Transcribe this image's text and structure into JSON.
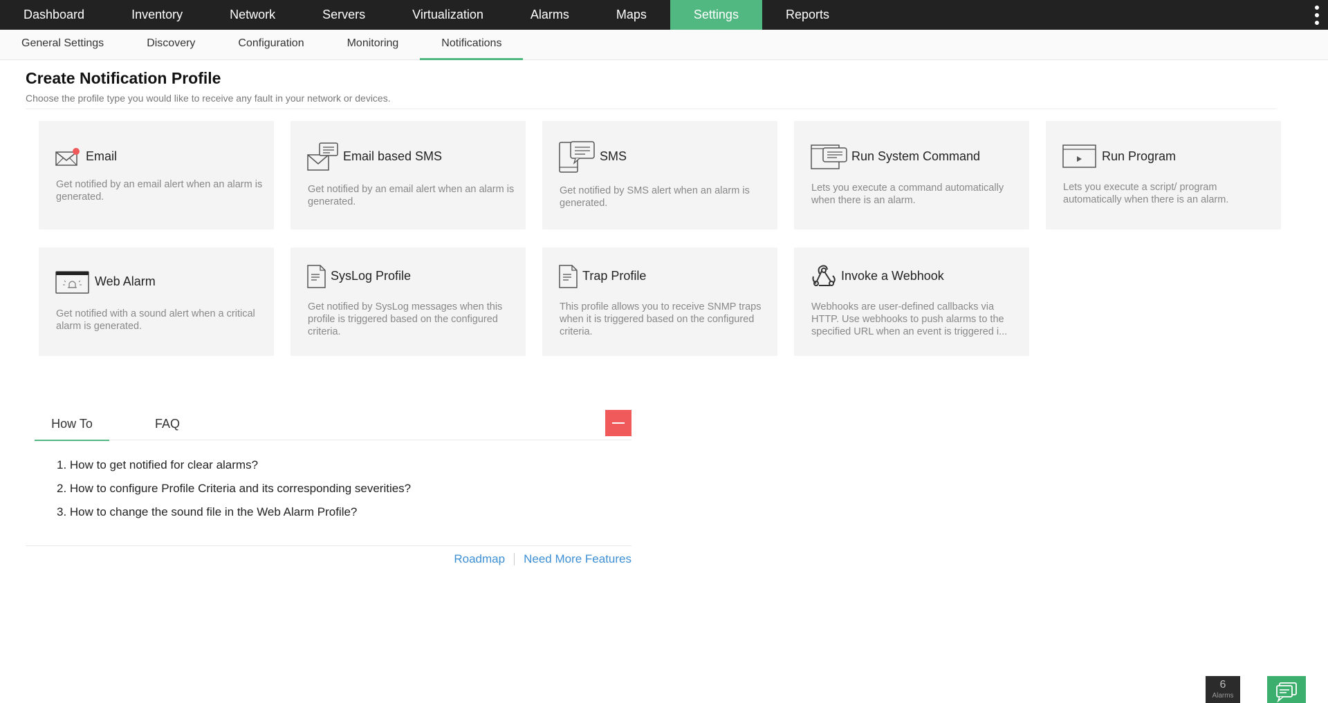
{
  "topnav": {
    "items": [
      {
        "label": "Dashboard"
      },
      {
        "label": "Inventory"
      },
      {
        "label": "Network"
      },
      {
        "label": "Servers"
      },
      {
        "label": "Virtualization"
      },
      {
        "label": "Alarms"
      },
      {
        "label": "Maps"
      },
      {
        "label": "Settings",
        "active": true
      },
      {
        "label": "Reports"
      }
    ]
  },
  "subnav": {
    "items": [
      {
        "label": "General Settings"
      },
      {
        "label": "Discovery"
      },
      {
        "label": "Configuration"
      },
      {
        "label": "Monitoring"
      },
      {
        "label": "Notifications",
        "active": true
      }
    ]
  },
  "header": {
    "title": "Create Notification Profile",
    "subtitle": "Choose the profile type you would like to receive any fault in your network or devices."
  },
  "cards": [
    {
      "title": "Email",
      "desc": "Get notified by an email alert when an alarm is generated.",
      "icon": "email-icon"
    },
    {
      "title": "Email based SMS",
      "desc": "Get notified by an email alert when an alarm is generated.",
      "icon": "email-sms-icon"
    },
    {
      "title": "SMS",
      "desc": "Get notified by SMS alert when an alarm is generated.",
      "icon": "sms-icon"
    },
    {
      "title": "Run System Command",
      "desc": "Lets you execute a command automatically when there is an alarm.",
      "icon": "system-command-icon"
    },
    {
      "title": "Run Program",
      "desc": "Lets you execute a script/ program automatically when there is an alarm.",
      "icon": "run-program-icon"
    },
    {
      "title": "Web Alarm",
      "desc": "Get notified with a sound alert when a critical alarm is generated.",
      "icon": "web-alarm-icon"
    },
    {
      "title": "SysLog Profile",
      "desc": "Get notified by SysLog messages when this profile is triggered based on the configured criteria.",
      "icon": "syslog-document-icon"
    },
    {
      "title": "Trap Profile",
      "desc": "This profile allows you to receive SNMP traps when it is triggered based on the configured criteria.",
      "icon": "trap-document-icon"
    },
    {
      "title": "Invoke a Webhook",
      "desc": "Webhooks are user-defined callbacks via HTTP. Use webhooks to push alarms to the specified URL when an event is triggered i...",
      "icon": "webhook-icon"
    }
  ],
  "help": {
    "tabs": [
      {
        "label": "How To",
        "active": true
      },
      {
        "label": "FAQ"
      }
    ],
    "items": [
      "1. How to get notified for clear alarms?",
      "2. How to configure Profile Criteria and its corresponding severities?",
      "3. How to change the sound file in the Web Alarm Profile?"
    ],
    "links": {
      "roadmap": "Roadmap",
      "more_features": "Need More Features"
    }
  },
  "widgets": {
    "alarm_count": "6",
    "alarm_label": "Alarms"
  },
  "colors": {
    "accent": "#52b882",
    "topbar": "#222222",
    "card_bg": "#f4f4f5",
    "collapse": "#f05a5a",
    "link": "#3d8fd4"
  }
}
